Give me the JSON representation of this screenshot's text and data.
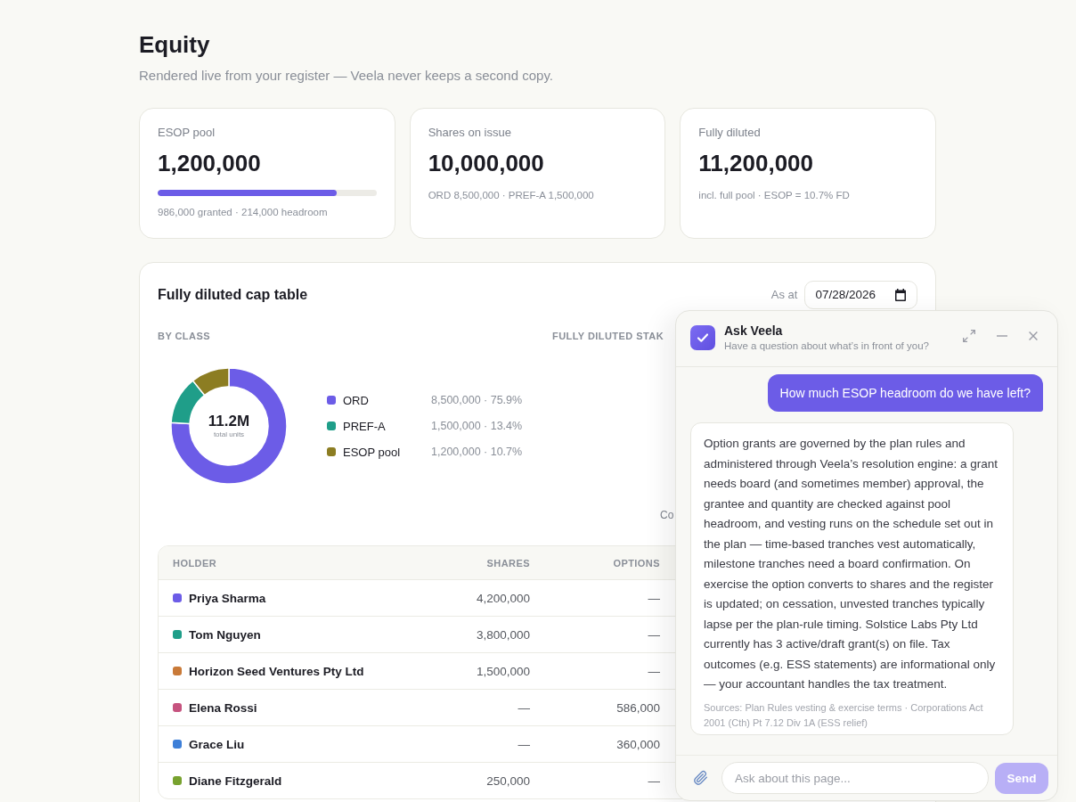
{
  "page": {
    "title": "Equity",
    "subtitle": "Rendered live from your register — Veela never keeps a second copy."
  },
  "stat_cards": [
    {
      "kind": "meter",
      "label": "ESOP pool",
      "value": "1,200,000",
      "level": 0.82,
      "note": "986,000 granted · 214,000 headroom"
    },
    {
      "kind": "plain",
      "label": "Shares on issue",
      "value": "10,000,000",
      "note": "ORD 8,500,000 · PREF-A 1,500,000"
    },
    {
      "kind": "plain",
      "label": "Fully diluted",
      "value": "11,200,000",
      "note": "incl. full pool · ESOP = 10.7% FD"
    }
  ],
  "cap_table": {
    "title": "Fully diluted cap table",
    "as_at": {
      "label": "As at",
      "value": "07/28/2026"
    },
    "by_class": {
      "heading": "BY CLASS",
      "center_value": "11.2M",
      "center_label": "total units",
      "chart_data": {
        "type": "donut",
        "categories": [
          "ORD",
          "PREF-A",
          "ESOP pool"
        ],
        "values": [
          75.9,
          13.4,
          10.7
        ]
      },
      "legend": [
        {
          "value": "8,500,000 · 75.9%",
          "color": "#6c5ce7"
        },
        {
          "value": "1,500,000 · 13.4%",
          "color": "#1f9e89"
        },
        {
          "value": "1,200,000 · 10.7%",
          "color": "#8c7d22"
        }
      ]
    },
    "stake": {
      "heading": "FULLY DILUTED STAK",
      "note": "Co"
    },
    "table": {
      "columns": [
        "HOLDER",
        "SHARES",
        "OPTIONS"
      ],
      "rows": [
        {
          "holder": "Priya Sharma",
          "color": "#6c5ce7",
          "shares": "4,200,000",
          "options": "—"
        },
        {
          "holder": "Tom Nguyen",
          "color": "#1f9e89",
          "shares": "3,800,000",
          "options": "—"
        },
        {
          "holder": "Horizon Seed Ventures Pty Ltd",
          "color": "#c97a38",
          "shares": "1,500,000",
          "options": "—"
        },
        {
          "holder": "Elena Rossi",
          "color": "#c6537f",
          "shares": "—",
          "options": "586,000"
        },
        {
          "holder": "Grace Liu",
          "color": "#3d7fd8",
          "shares": "—",
          "options": "360,000"
        },
        {
          "holder": "Diane Fitzgerald",
          "color": "#78a22f",
          "shares": "250,000",
          "options": "—"
        }
      ]
    }
  },
  "chat": {
    "title": "Ask Veela",
    "subtitle": "Have a question about what’s in front of you?",
    "messages": [
      {
        "kind": "user",
        "text": "How much ESOP headroom do we have left?"
      },
      {
        "kind": "assistant",
        "text": "Option grants are governed by the plan rules and administered through Veela’s resolution engine: a grant needs board (and sometimes member) approval, the grantee and quantity are checked against pool headroom, and vesting runs on the schedule set out in the plan — time-based tranches vest automatically, milestone tranches need a board confirmation. On exercise the option converts to shares and the register is updated; on cessation, unvested tranches typically lapse per the plan-rule timing. Solstice Labs Pty Ltd currently has 3 active/draft grant(s) on file. Tax outcomes (e.g. ESS statements) are informational only — your accountant handles the tax treatment.",
        "sources": "Sources: Plan Rules vesting & exercise terms · Corporations Act 2001 (Cth) Pt 7.12 Div 1A (ESS relief)"
      }
    ],
    "input": {
      "placeholder": "Ask about this page..."
    },
    "send_button": {
      "label": "Send",
      "disabled": true
    }
  }
}
